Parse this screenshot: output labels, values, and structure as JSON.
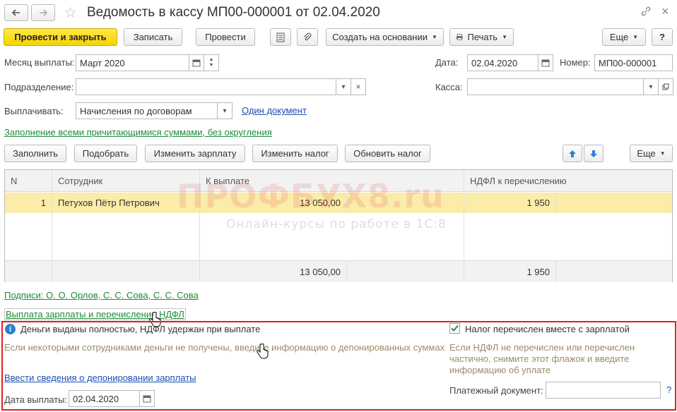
{
  "window": {
    "title": "Ведомость в кассу МП00-000001 от 02.04.2020"
  },
  "toolbar": {
    "post_close": "Провести и закрыть",
    "save": "Записать",
    "post": "Провести",
    "create_based": "Создать на основании",
    "print": "Печать",
    "more": "Еще",
    "help": "?"
  },
  "header": {
    "month_label": "Месяц выплаты:",
    "month_value": "Март 2020",
    "date_label": "Дата:",
    "date_value": "02.04.2020",
    "number_label": "Номер:",
    "number_value": "МП00-000001",
    "department_label": "Подразделение:",
    "department_value": "",
    "cash_label": "Касса:",
    "cash_value": "",
    "pay_label": "Выплачивать:",
    "pay_value": "Начисления по договорам",
    "one_doc_link": "Один документ",
    "fill_link": "Заполнение всеми причитающимися суммами, без округления"
  },
  "table_toolbar": {
    "fill": "Заполнить",
    "select": "Подобрать",
    "change_salary": "Изменить зарплату",
    "change_tax": "Изменить налог",
    "update_tax": "Обновить налог",
    "more": "Еще"
  },
  "table": {
    "columns": [
      "N",
      "Сотрудник",
      "К выплате",
      "НДФЛ к перечислению"
    ],
    "rows": [
      {
        "n": "1",
        "employee": "Петухов Пётр Петрович",
        "amount": "13 050,00",
        "tax": "1 950"
      }
    ],
    "totals": {
      "amount": "13 050,00",
      "tax": "1 950"
    }
  },
  "watermark": {
    "brand": "ПРОФБУХ8.ru",
    "tagline": "Онлайн-курсы по работе в 1С:8"
  },
  "signatures_link": "Подписи: О. О. Орлов, С. С. Сова, С. С. Сова",
  "payment_link": "Выплата зарплаты и перечисление НДФЛ",
  "payment_panel": {
    "info_text": "Деньги выданы полностью, НДФЛ удержан при выплате",
    "hint_left": "Если некоторыми сотрудниками деньги не получены, введите информацию о депонированных суммах",
    "deposit_link": "Ввести сведения о депонировании зарплаты",
    "pay_date_label": "Дата выплаты:",
    "pay_date_value": "02.04.2020",
    "tax_checkbox_label": "Налог перечислен вместе с зарплатой",
    "tax_checked": true,
    "hint_right": "Если НДФЛ не перечислен или перечислен частично, снимите этот флажок и введите информацию об уплате",
    "payment_doc_label": "Платежный документ:",
    "payment_doc_value": "",
    "question": "?"
  },
  "colors": {
    "primary_button": "#f6d300",
    "link_green": "#1f8a3a",
    "link_blue": "#1b4fb0",
    "highlight_box": "#e02020",
    "selected_row": "#fbecaa"
  }
}
